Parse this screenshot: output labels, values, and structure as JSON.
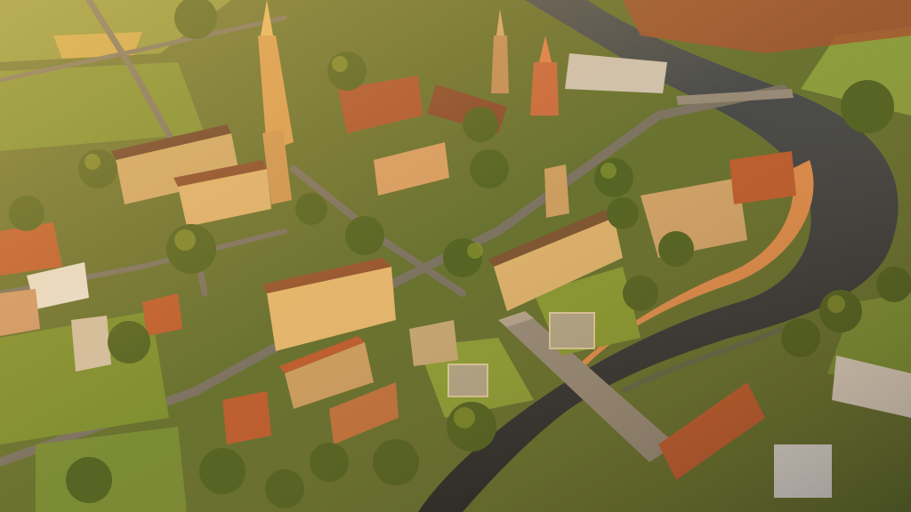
{
  "image": {
    "kind": "aerial-photo",
    "subject": "european-old-town-river-bend",
    "lighting": "golden-hour",
    "colors": {
      "river": "#1d2a33",
      "river_highlight": "#4a5560",
      "grass": "#5f7a2c",
      "grass_light": "#8fa23c",
      "trees": "#3f5a1c",
      "tree_light": "#7a8f2a",
      "roof_red": "#b5532a",
      "roof_dark": "#5a3424",
      "facade": "#c9a66b",
      "facade_warm": "#e0b56e",
      "road": "#6b6a62",
      "embankment": "#d9884a",
      "sunlight": "#ffb45a"
    }
  }
}
